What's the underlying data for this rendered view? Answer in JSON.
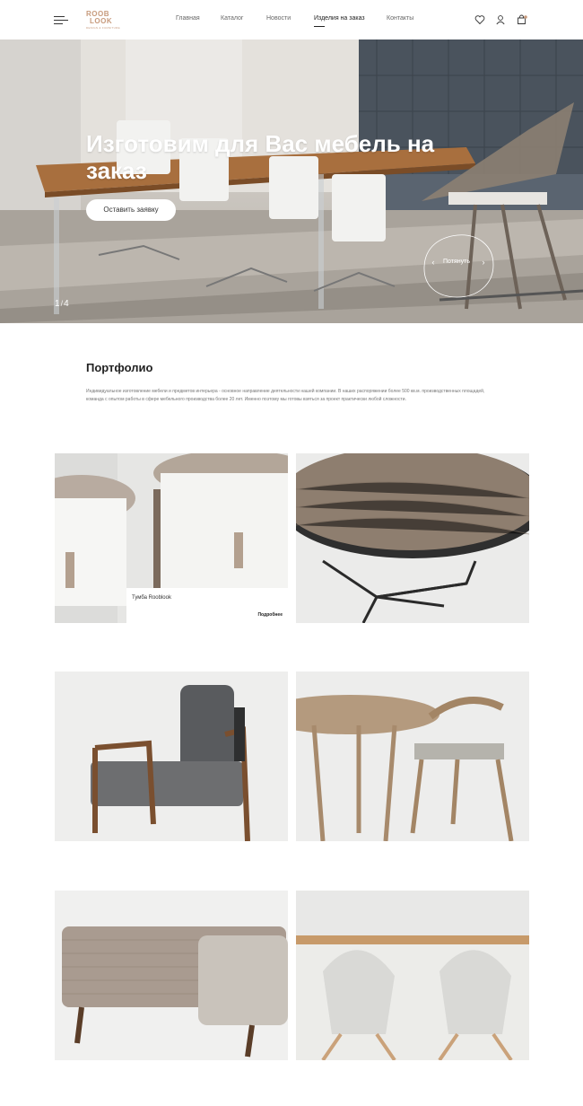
{
  "header": {
    "logo": {
      "line1": "ROOB",
      "line2": "LOOK",
      "tagline": "DESIGN & FURNITURE"
    },
    "nav": [
      {
        "label": "Главная"
      },
      {
        "label": "Каталог"
      },
      {
        "label": "Новости"
      },
      {
        "label": "Изделия на заказ",
        "active": true
      },
      {
        "label": "Контакты"
      }
    ],
    "icons": [
      "menu-icon",
      "heart-icon",
      "user-icon",
      "cart-icon"
    ]
  },
  "hero": {
    "title": "Изготовим для Вас мебель на заказ",
    "cta_label": "Оставить заявку",
    "slide_current": "1",
    "slide_separator": "/",
    "slide_total": "4",
    "drag_label": "Потянуть",
    "prev_arrow": "‹",
    "next_arrow": "›"
  },
  "portfolio": {
    "title": "Портфолио",
    "description": "Индивидуальное изготовление мебели и предметов интерьера - основное направление деятельности нашей компании. В наших распоряжении более 500 кв.м. производственных площадей, команда с опытом работы в сфере мебельного производства более 20 лет. Именно поэтому мы готовы взяться за проект практически любой сложности.",
    "items": [
      {
        "name": "Тумба Rooblook",
        "more_label": "Подробнее"
      },
      {
        "name": ""
      },
      {
        "name": ""
      },
      {
        "name": ""
      },
      {
        "name": ""
      },
      {
        "name": ""
      }
    ]
  },
  "colors": {
    "accent": "#c79a7c",
    "text": "#222222",
    "muted": "#777777",
    "hero_title": "#ffffff"
  }
}
